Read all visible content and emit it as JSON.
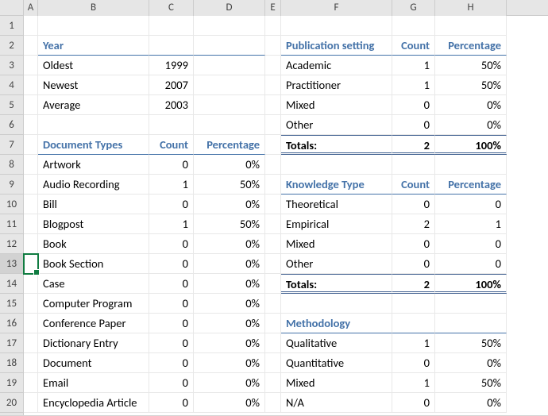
{
  "columns": [
    "A",
    "B",
    "C",
    "D",
    "E",
    "F",
    "G",
    "H"
  ],
  "rowCount": 20,
  "year": {
    "title": "Year",
    "rows": [
      {
        "label": "Oldest",
        "value": "1999"
      },
      {
        "label": "Newest",
        "value": "2007"
      },
      {
        "label": "Average",
        "value": "2003"
      }
    ]
  },
  "docTypes": {
    "title": "Document Types",
    "countHdr": "Count",
    "pctHdr": "Percentage",
    "rows": [
      {
        "label": "Artwork",
        "count": "0",
        "pct": "0%"
      },
      {
        "label": "Audio Recording",
        "count": "1",
        "pct": "50%"
      },
      {
        "label": "Bill",
        "count": "0",
        "pct": "0%"
      },
      {
        "label": "Blogpost",
        "count": "1",
        "pct": "50%"
      },
      {
        "label": "Book",
        "count": "0",
        "pct": "0%"
      },
      {
        "label": "Book Section",
        "count": "0",
        "pct": "0%"
      },
      {
        "label": "Case",
        "count": "0",
        "pct": "0%"
      },
      {
        "label": "Computer Program",
        "count": "0",
        "pct": "0%"
      },
      {
        "label": "Conference Paper",
        "count": "0",
        "pct": "0%"
      },
      {
        "label": "Dictionary Entry",
        "count": "0",
        "pct": "0%"
      },
      {
        "label": "Document",
        "count": "0",
        "pct": "0%"
      },
      {
        "label": "Email",
        "count": "0",
        "pct": "0%"
      },
      {
        "label": "Encyclopedia Article",
        "count": "0",
        "pct": "0%"
      }
    ]
  },
  "pubSetting": {
    "title": "Publication setting",
    "countHdr": "Count",
    "pctHdr": "Percentage",
    "rows": [
      {
        "label": "Academic",
        "count": "1",
        "pct": "50%"
      },
      {
        "label": "Practitioner",
        "count": "1",
        "pct": "50%"
      },
      {
        "label": "Mixed",
        "count": "0",
        "pct": "0%"
      },
      {
        "label": "Other",
        "count": "0",
        "pct": "0%"
      }
    ],
    "totalsLabel": "Totals:",
    "totalsCount": "2",
    "totalsPct": "100%"
  },
  "knowledgeType": {
    "title": "Knowledge Type",
    "countHdr": "Count",
    "pctHdr": "Percentage",
    "rows": [
      {
        "label": "Theoretical",
        "count": "0",
        "pct": "0"
      },
      {
        "label": "Empirical",
        "count": "2",
        "pct": "1"
      },
      {
        "label": "Mixed",
        "count": "0",
        "pct": "0"
      },
      {
        "label": "Other",
        "count": "0",
        "pct": "0"
      }
    ],
    "totalsLabel": "Totals:",
    "totalsCount": "2",
    "totalsPct": "100%"
  },
  "methodology": {
    "title": "Methodology",
    "rows": [
      {
        "label": "Qualitative",
        "count": "1",
        "pct": "50%"
      },
      {
        "label": "Quantitative",
        "count": "0",
        "pct": "0%"
      },
      {
        "label": "Mixed",
        "count": "1",
        "pct": "50%"
      },
      {
        "label": "N/A",
        "count": "0",
        "pct": "0%"
      }
    ]
  },
  "selectedCell": "A13"
}
